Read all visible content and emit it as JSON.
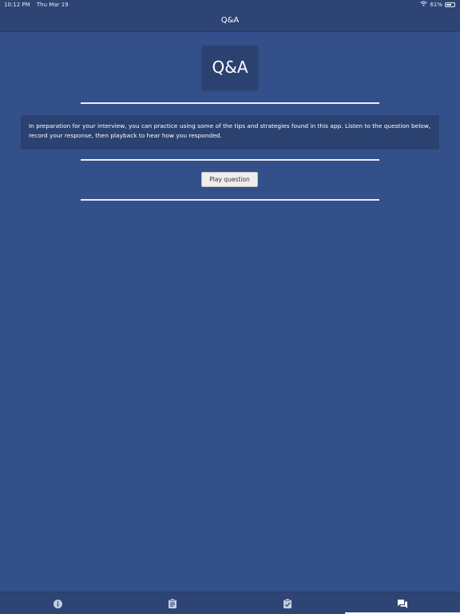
{
  "status_bar": {
    "time": "10:12 PM",
    "date": "Thu Mar 19",
    "battery_text": "61%",
    "battery_level": 0.61,
    "wifi_icon": "wifi-icon",
    "battery_icon": "battery-icon"
  },
  "nav": {
    "title": "Q&A"
  },
  "logo": {
    "text": "Q&A"
  },
  "info": {
    "text": "In preparation for your interview, you can practice using some of the tips and strategies found in this app. Listen to the question below, record your response, then playback to hear how you responded."
  },
  "player": {
    "play_label": "Play question"
  },
  "colors": {
    "background": "#34508a",
    "bar": "#2d4474",
    "card": "#2b4270",
    "divider": "#e8edf7"
  },
  "tabs": [
    {
      "icon": "info-icon",
      "active": false
    },
    {
      "icon": "clipboard-icon",
      "active": false
    },
    {
      "icon": "checklist-icon",
      "active": false
    },
    {
      "icon": "chat-icon",
      "active": true
    }
  ]
}
